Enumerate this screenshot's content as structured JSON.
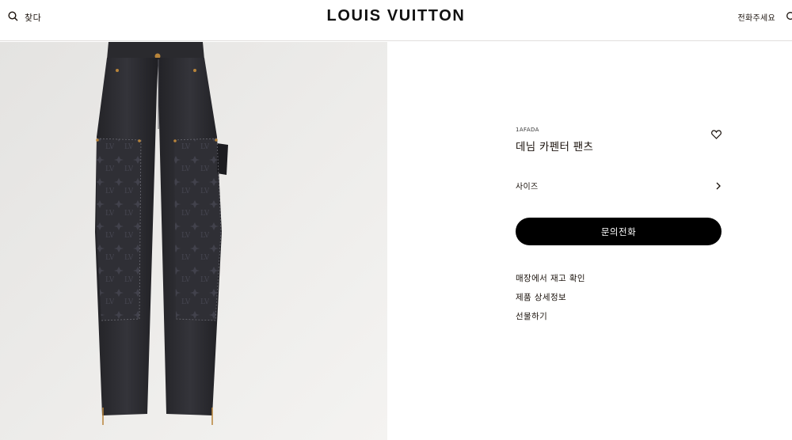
{
  "header": {
    "search_label": "찾다",
    "brand": "LOUIS VUITTON",
    "call_label": "전화주세요"
  },
  "product": {
    "sku": "1AFADA",
    "name": "데님 카펜터 팬츠",
    "size_label": "사이즈",
    "cta_label": "문의전화",
    "links": [
      "매장에서 재고 확인",
      "제품 상세정보",
      "선물하기"
    ]
  },
  "colors": {
    "background": "#ffffff",
    "image_background": "#eae9e7",
    "denim": "#2b2b2e",
    "cta": "#000000",
    "text": "#19110b"
  },
  "icons": [
    "search-icon",
    "chat-icon",
    "heart-icon",
    "chevron-right-icon"
  ]
}
